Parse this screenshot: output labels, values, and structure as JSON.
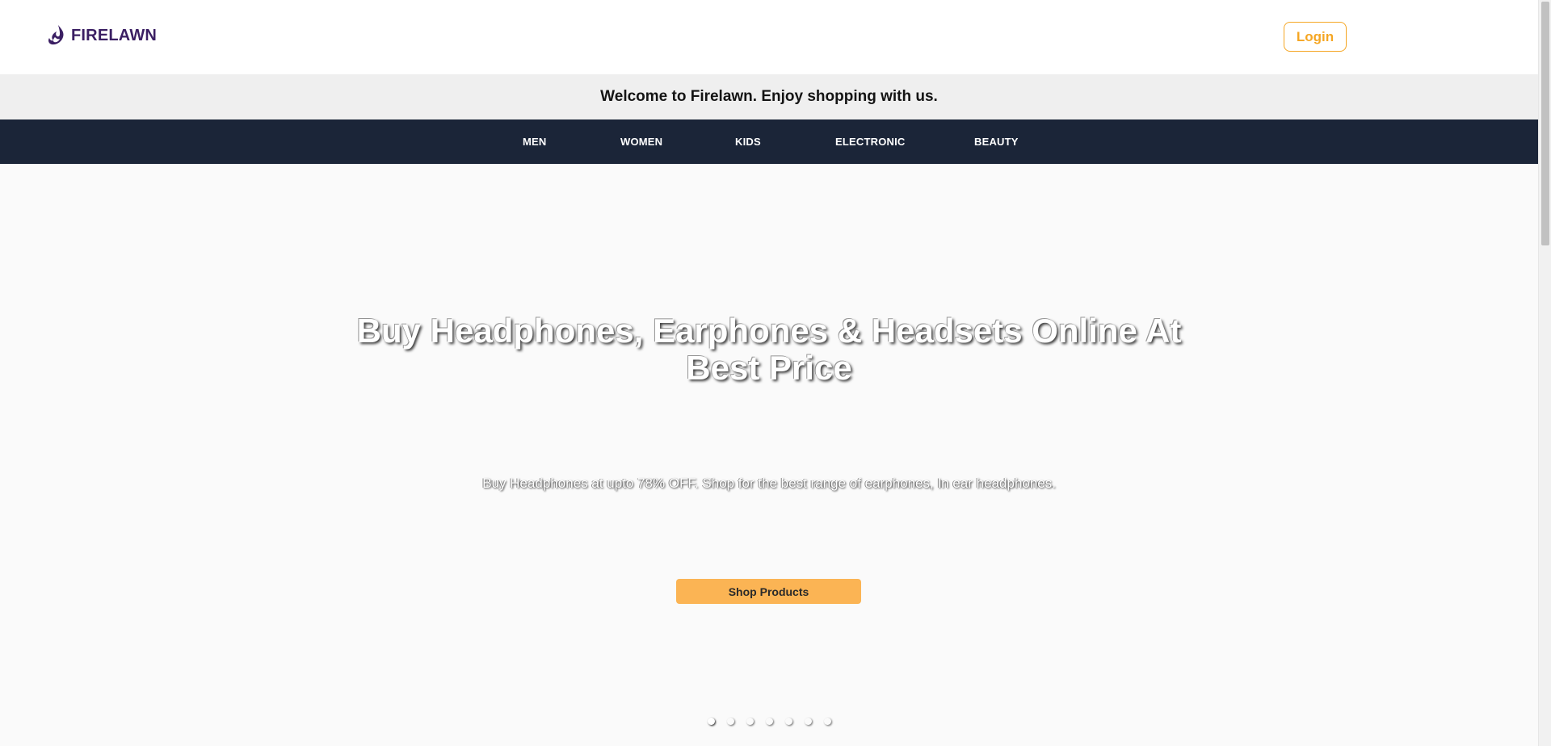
{
  "brand": {
    "name": "FIRELAWN",
    "logo_color": "#3b1f63"
  },
  "header": {
    "login_label": "Login",
    "accent_color": "#f5a623"
  },
  "welcome": {
    "text": "Welcome to Firelawn. Enjoy shopping with us."
  },
  "nav": {
    "items": [
      {
        "label": "MEN"
      },
      {
        "label": "WOMEN"
      },
      {
        "label": "KIDS"
      },
      {
        "label": "ELECTRONIC"
      },
      {
        "label": "BEAUTY"
      }
    ],
    "background": "#1b2538"
  },
  "hero": {
    "title": "Buy Headphones, Earphones & Headsets Online At Best Price",
    "subtitle": "Buy Headphones at upto 78% OFF. Shop for the best range of earphones, In ear headphones.",
    "cta_label": "Shop Products",
    "cta_color": "#fbb454",
    "slide_count": 7,
    "active_slide": 1
  }
}
